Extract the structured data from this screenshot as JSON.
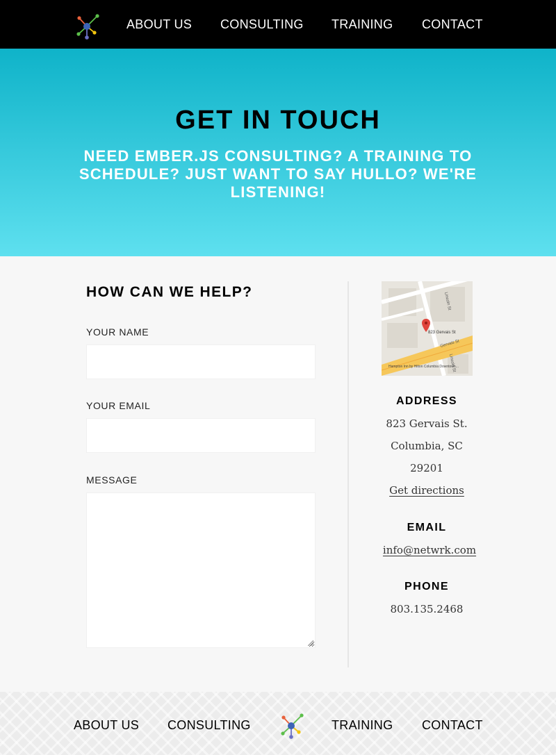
{
  "nav": {
    "about": "ABOUT US",
    "consulting": "CONSULTING",
    "training": "TRAINING",
    "contact": "CONTACT",
    "logo_icon": "network-node-icon"
  },
  "hero": {
    "title": "GET IN TOUCH",
    "subtitle": "NEED EMBER.JS CONSULTING? A TRAINING TO SCHEDULE? JUST WANT TO SAY HULLO? WE'RE LISTENING!"
  },
  "form": {
    "title": "HOW CAN WE HELP?",
    "name_label": "YOUR NAME",
    "name_value": "",
    "email_label": "YOUR EMAIL",
    "email_value": "",
    "message_label": "MESSAGE",
    "message_value": ""
  },
  "contact_info": {
    "map_labels": {
      "address": "823 Gervais St",
      "street_1": "Gervais St",
      "street_2": "Lincoln St",
      "street_3": "Lincoln St",
      "poi": "Hampton Inn by Hilton Columbia Downtown..."
    },
    "address_heading": "ADDRESS",
    "address_line1": "823 Gervais St.",
    "address_line2": "Columbia, SC",
    "address_line3": "29201",
    "directions_link": "Get directions",
    "email_heading": "EMAIL",
    "email": "info@netwrk.com",
    "phone_heading": "PHONE",
    "phone": "803.135.2468"
  },
  "colors": {
    "hero_top": "#0fb3c9",
    "hero_bottom": "#5ee0ef",
    "nav_bg": "#000000"
  }
}
